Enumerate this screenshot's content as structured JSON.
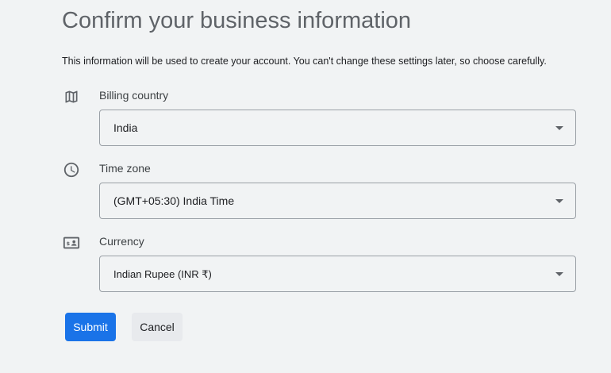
{
  "header": {
    "title": "Confirm your business information",
    "subtitle": "This information will be used to create your account. You can't change these settings later, so choose carefully."
  },
  "fields": {
    "billing_country": {
      "icon": "map-icon",
      "label": "Billing country",
      "value": "India"
    },
    "time_zone": {
      "icon": "clock-icon",
      "label": "Time zone",
      "value": "(GMT+05:30) India Time"
    },
    "currency": {
      "icon": "currency-icon",
      "label": "Currency",
      "value": "Indian Rupee (INR ₹)"
    }
  },
  "actions": {
    "submit_label": "Submit",
    "cancel_label": "Cancel"
  },
  "colors": {
    "background": "#f1f3f4",
    "primary": "#1a73e8",
    "secondary_button": "#e8eaed",
    "title": "#5f6368",
    "icon": "#5f6368"
  }
}
